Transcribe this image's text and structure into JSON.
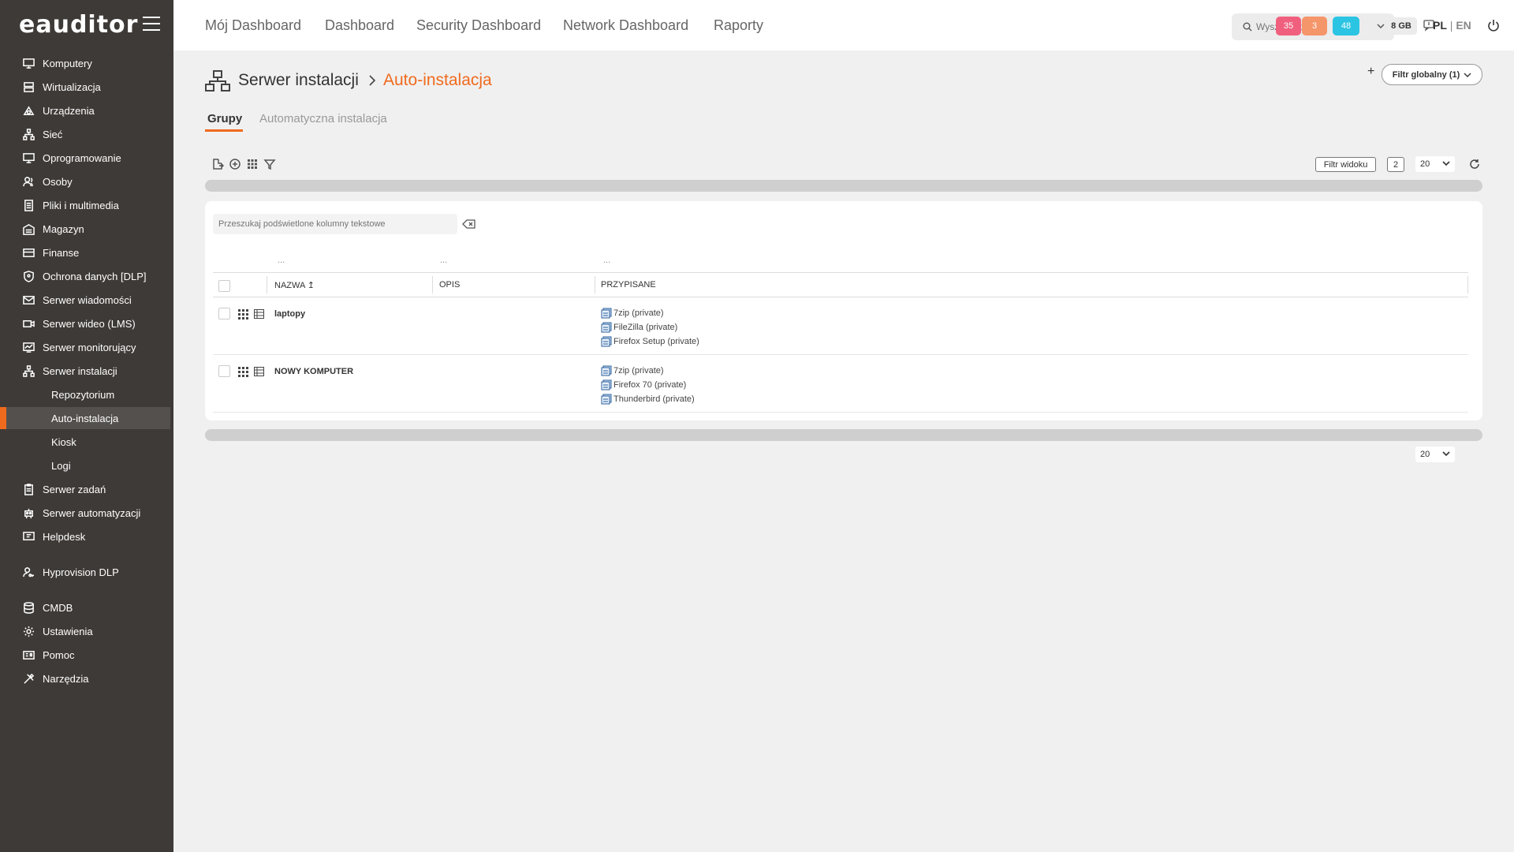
{
  "app": {
    "logo": "eauditor"
  },
  "sidebar": {
    "items": [
      {
        "label": "Komputery",
        "icon": "monitor-icon"
      },
      {
        "label": "Wirtualizacja",
        "icon": "server-stack-icon"
      },
      {
        "label": "Urządzenia",
        "icon": "devices-icon"
      },
      {
        "label": "Sieć",
        "icon": "network-icon"
      },
      {
        "label": "Oprogramowanie",
        "icon": "monitor-icon"
      },
      {
        "label": "Osoby",
        "icon": "users-icon"
      },
      {
        "label": "Pliki i multimedia",
        "icon": "file-icon"
      },
      {
        "label": "Magazyn",
        "icon": "warehouse-icon"
      },
      {
        "label": "Finanse",
        "icon": "credit-card-icon"
      },
      {
        "label": "Ochrona danych [DLP]",
        "icon": "shield-icon"
      },
      {
        "label": "Serwer wiadomości",
        "icon": "mail-icon"
      },
      {
        "label": "Serwer wideo (LMS)",
        "icon": "video-icon"
      },
      {
        "label": "Serwer monitorujący",
        "icon": "monitor-chart-icon"
      },
      {
        "label": "Serwer instalacji",
        "icon": "network-icon"
      },
      {
        "label": "Repozytorium"
      },
      {
        "label": "Auto-instalacja"
      },
      {
        "label": "Kiosk"
      },
      {
        "label": "Logi"
      },
      {
        "label": "Serwer zadań",
        "icon": "clipboard-icon"
      },
      {
        "label": "Serwer automatyzacji",
        "icon": "robot-icon"
      },
      {
        "label": "Helpdesk",
        "icon": "helpdesk-icon"
      },
      {
        "label": "Hyprovision DLP",
        "icon": "user-key-icon"
      },
      {
        "label": "CMDB",
        "icon": "database-icon"
      },
      {
        "label": "Ustawienia",
        "icon": "gear-icon"
      },
      {
        "label": "Pomoc",
        "icon": "help-card-icon"
      },
      {
        "label": "Narzędzia",
        "icon": "tools-icon"
      }
    ]
  },
  "topnav": [
    "Mój Dashboard",
    "Dashboard",
    "Security Dashboard",
    "Network Dashboard",
    "Raporty"
  ],
  "search": {
    "placeholder": "Wyszukaj tekst"
  },
  "badges": [
    {
      "value": "35",
      "color": "#f0607e"
    },
    {
      "value": "3",
      "color": "#f5956a"
    },
    {
      "value": "48",
      "color": "#2cc4e3"
    }
  ],
  "memory": "8 GB",
  "lang": {
    "pl": "PL",
    "sep": " | ",
    "en": "EN"
  },
  "breadcrumb": {
    "parent": "Serwer instalacji",
    "current": "Auto-instalacja"
  },
  "add_label": "+",
  "global_filter": "Filtr globalny (1)",
  "tabs": [
    "Grupy",
    "Automatyczna instalacja"
  ],
  "toolbar": {
    "view_filter": "Filtr widoku",
    "view_count": "2",
    "page_size": "20"
  },
  "table": {
    "search_placeholder": "Przeszukaj podświetlone kolumny tekstowe",
    "filter_placeholder": "...",
    "headers": [
      "NAZWA",
      "OPIS",
      "PRZYPISANE"
    ],
    "sort_indicator": "↥",
    "rows": [
      {
        "name": "laptopy",
        "description": "",
        "assigned": [
          "7zip (private)",
          "FileZilla (private)",
          "Firefox Setup (private)"
        ]
      },
      {
        "name": "NOWY KOMPUTER",
        "description": "",
        "assigned": [
          "7zip (private)",
          "Firefox 70 (private)",
          "Thunderbird (private)"
        ]
      }
    ]
  },
  "colors": {
    "accent": "#f06a1d",
    "sidebar_bg": "#3e3a37"
  }
}
